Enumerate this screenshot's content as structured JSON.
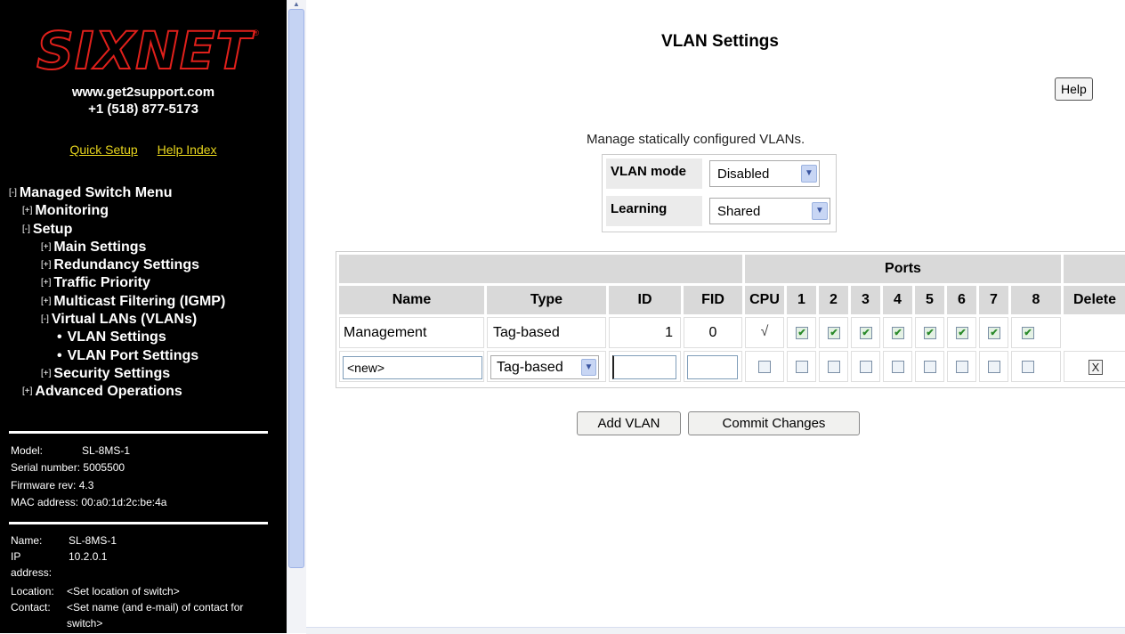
{
  "brand": {
    "logo_text": "SIXNET",
    "logo_registered": "®",
    "logo_color": "#e0201b",
    "website": "www.get2support.com",
    "phone": "+1 (518) 877-5173"
  },
  "links": {
    "quick_setup": "Quick Setup",
    "help_index": "Help Index"
  },
  "menu": {
    "root": {
      "toggle": "[-]",
      "label": "Managed Switch Menu"
    },
    "monitoring": {
      "toggle": "[+]",
      "label": "Monitoring"
    },
    "setup": {
      "toggle": "[-]",
      "label": "Setup"
    },
    "main_settings": {
      "toggle": "[+]",
      "label": "Main Settings"
    },
    "redundancy": {
      "toggle": "[+]",
      "label": "Redundancy Settings"
    },
    "traffic": {
      "toggle": "[+]",
      "label": "Traffic Priority"
    },
    "multicast": {
      "toggle": "[+]",
      "label": "Multicast Filtering (IGMP)"
    },
    "vlans": {
      "toggle": "[-]",
      "label": "Virtual LANs (VLANs)"
    },
    "vlan_settings": {
      "bullet": "•",
      "label": "VLAN Settings"
    },
    "vlan_port": {
      "bullet": "•",
      "label": "VLAN Port Settings"
    },
    "security": {
      "toggle": "[+]",
      "label": "Security Settings"
    },
    "advanced": {
      "toggle": "[+]",
      "label": "Advanced Operations"
    }
  },
  "device": {
    "model_label": "Model:",
    "model": "SL-8MS-1",
    "serial_label": "Serial number:",
    "serial": "5005500",
    "firmware_label": "Firmware rev:",
    "firmware": "4.3",
    "mac_label": "MAC address:",
    "mac": "00:a0:1d:2c:be:4a",
    "name_label": "Name:",
    "name": "SL-8MS-1",
    "ip_label": "IP address:",
    "ip": "10.2.0.1",
    "location_label": "Location:",
    "location": "<Set location of switch>",
    "contact_label": "Contact:",
    "contact": "<Set name (and e-mail) of contact for switch>"
  },
  "page": {
    "title": "VLAN Settings",
    "help_button": "Help",
    "description": "Manage statically configured VLANs.",
    "vlan_mode_label": "VLAN mode",
    "vlan_mode_value": "Disabled",
    "learning_label": "Learning",
    "learning_value": "Shared"
  },
  "table": {
    "ports_header": "Ports",
    "columns": {
      "name": "Name",
      "type": "Type",
      "id": "ID",
      "fid": "FID",
      "cpu": "CPU",
      "p1": "1",
      "p2": "2",
      "p3": "3",
      "p4": "4",
      "p5": "5",
      "p6": "6",
      "p7": "7",
      "p8": "8",
      "delete": "Delete"
    },
    "row1": {
      "name": "Management",
      "type": "Tag-based",
      "id": "1",
      "fid": "0",
      "cpu": "√",
      "ports_checked": [
        true,
        true,
        true,
        true,
        true,
        true,
        true,
        true
      ]
    },
    "row2": {
      "name": "<new>",
      "type": "Tag-based",
      "id": "",
      "fid": "",
      "cpu_checked": false,
      "ports_checked": [
        false,
        false,
        false,
        false,
        false,
        false,
        false,
        false
      ],
      "delete_mark": "X"
    }
  },
  "buttons": {
    "add_vlan": "Add VLAN",
    "commit": "Commit Changes"
  },
  "icons": {
    "dropdown": "chevron-down-icon",
    "check": "checkmark-icon"
  }
}
